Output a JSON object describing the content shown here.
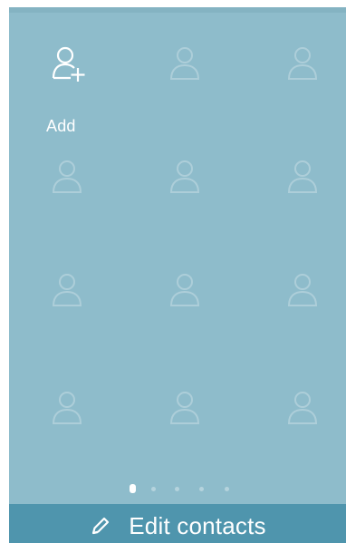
{
  "contacts_grid": {
    "add_label": "Add",
    "add_icon": "add-contact-icon",
    "placeholder_icon": "contact-placeholder-icon"
  },
  "pager": {
    "pages": 5,
    "active_page": 1
  },
  "bottom_bar": {
    "label": "Edit contacts",
    "icon": "pencil-icon"
  },
  "colors": {
    "panel": "#8ebccb",
    "bottom_bar": "#4f95ad",
    "text": "#ffffff"
  }
}
